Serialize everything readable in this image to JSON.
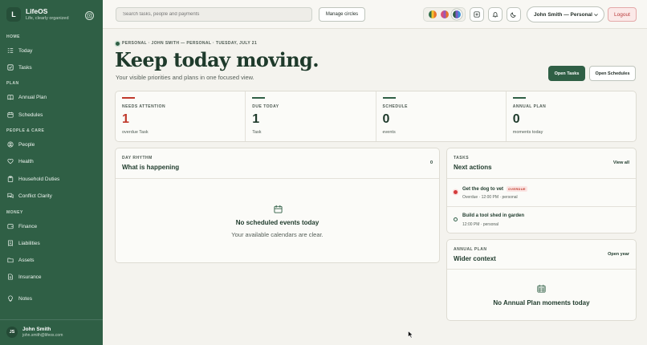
{
  "app": {
    "name": "LifeOS",
    "tagline": "Life, clearly organized",
    "logo_letter": "L"
  },
  "sidebar": {
    "sections": [
      {
        "label": "HOME",
        "items": [
          {
            "label": "Today",
            "icon": "layout-list-icon"
          },
          {
            "label": "Tasks",
            "icon": "check-square-icon"
          }
        ]
      },
      {
        "label": "PLAN",
        "items": [
          {
            "label": "Annual Plan",
            "icon": "book-open-icon"
          },
          {
            "label": "Schedules",
            "icon": "calendar-icon"
          }
        ]
      },
      {
        "label": "PEOPLE & CARE",
        "items": [
          {
            "label": "People",
            "icon": "user-circle-icon"
          },
          {
            "label": "Health",
            "icon": "heart-icon"
          },
          {
            "label": "Household Duties",
            "icon": "clipboard-icon"
          },
          {
            "label": "Conflict Clarity",
            "icon": "chat-bubbles-icon"
          }
        ]
      },
      {
        "label": "MONEY",
        "items": [
          {
            "label": "Finance",
            "icon": "wallet-icon"
          },
          {
            "label": "Liabilities",
            "icon": "receipt-icon"
          },
          {
            "label": "Assets",
            "icon": "folder-icon"
          },
          {
            "label": "Insurance",
            "icon": "document-icon"
          }
        ]
      },
      {
        "label": "",
        "items": [
          {
            "label": "Notes",
            "icon": "lightbulb-icon"
          }
        ]
      }
    ],
    "user": {
      "initials": "JS",
      "name": "John Smith",
      "email": "john.smith@lifeos.com"
    }
  },
  "topbar": {
    "search_placeholder": "Search tasks, people and payments",
    "manage_circles": "Manage circles",
    "account": "John Smith — Personal",
    "logout": "Logout",
    "circle_colors": [
      [
        "#2f6d48",
        "#f2c12e",
        "#e8742a"
      ],
      [
        "#d94f7a",
        "#9b59b6",
        "#e8742a"
      ],
      [
        "#2f5f45",
        "#7b5cc4",
        "#3b8fd6"
      ]
    ]
  },
  "header": {
    "crumb": "PERSONAL · JOHN SMITH — PERSONAL · TUESDAY, JULY 21",
    "title": "Keep today moving.",
    "subtitle": "Your visible priorities and plans in one focused view.",
    "open_tasks": "Open Tasks",
    "open_schedules": "Open Schedules"
  },
  "stats": [
    {
      "label": "NEEDS ATTENTION",
      "value": "1",
      "sub": "overdue Task",
      "accent": "#c0392b"
    },
    {
      "label": "DUE TODAY",
      "value": "1",
      "sub": "Task",
      "accent": "#2f5f45"
    },
    {
      "label": "SCHEDULE",
      "value": "0",
      "sub": "events",
      "accent": "#2f5f45"
    },
    {
      "label": "ANNUAL PLAN",
      "value": "0",
      "sub": "moments today",
      "accent": "#2f5f45"
    }
  ],
  "day_rhythm": {
    "eyebrow": "DAY RHYTHM",
    "title": "What is happening",
    "count": "0",
    "empty_title": "No scheduled events today",
    "empty_sub": "Your available calendars are clear."
  },
  "tasks": {
    "eyebrow": "TASKS",
    "title": "Next actions",
    "link": "View all",
    "items": [
      {
        "title": "Get the dog to vet",
        "badge": "OVERDUE",
        "meta": "Overdue · 12:00 PM · personal",
        "status": "overdue"
      },
      {
        "title": "Build a tool shed in garden",
        "badge": "",
        "meta": "12:00 PM · personal",
        "status": "open"
      }
    ]
  },
  "annual_plan": {
    "eyebrow": "ANNUAL PLAN",
    "title": "Wider context",
    "link": "Open year",
    "empty_title": "No Annual Plan moments today"
  }
}
